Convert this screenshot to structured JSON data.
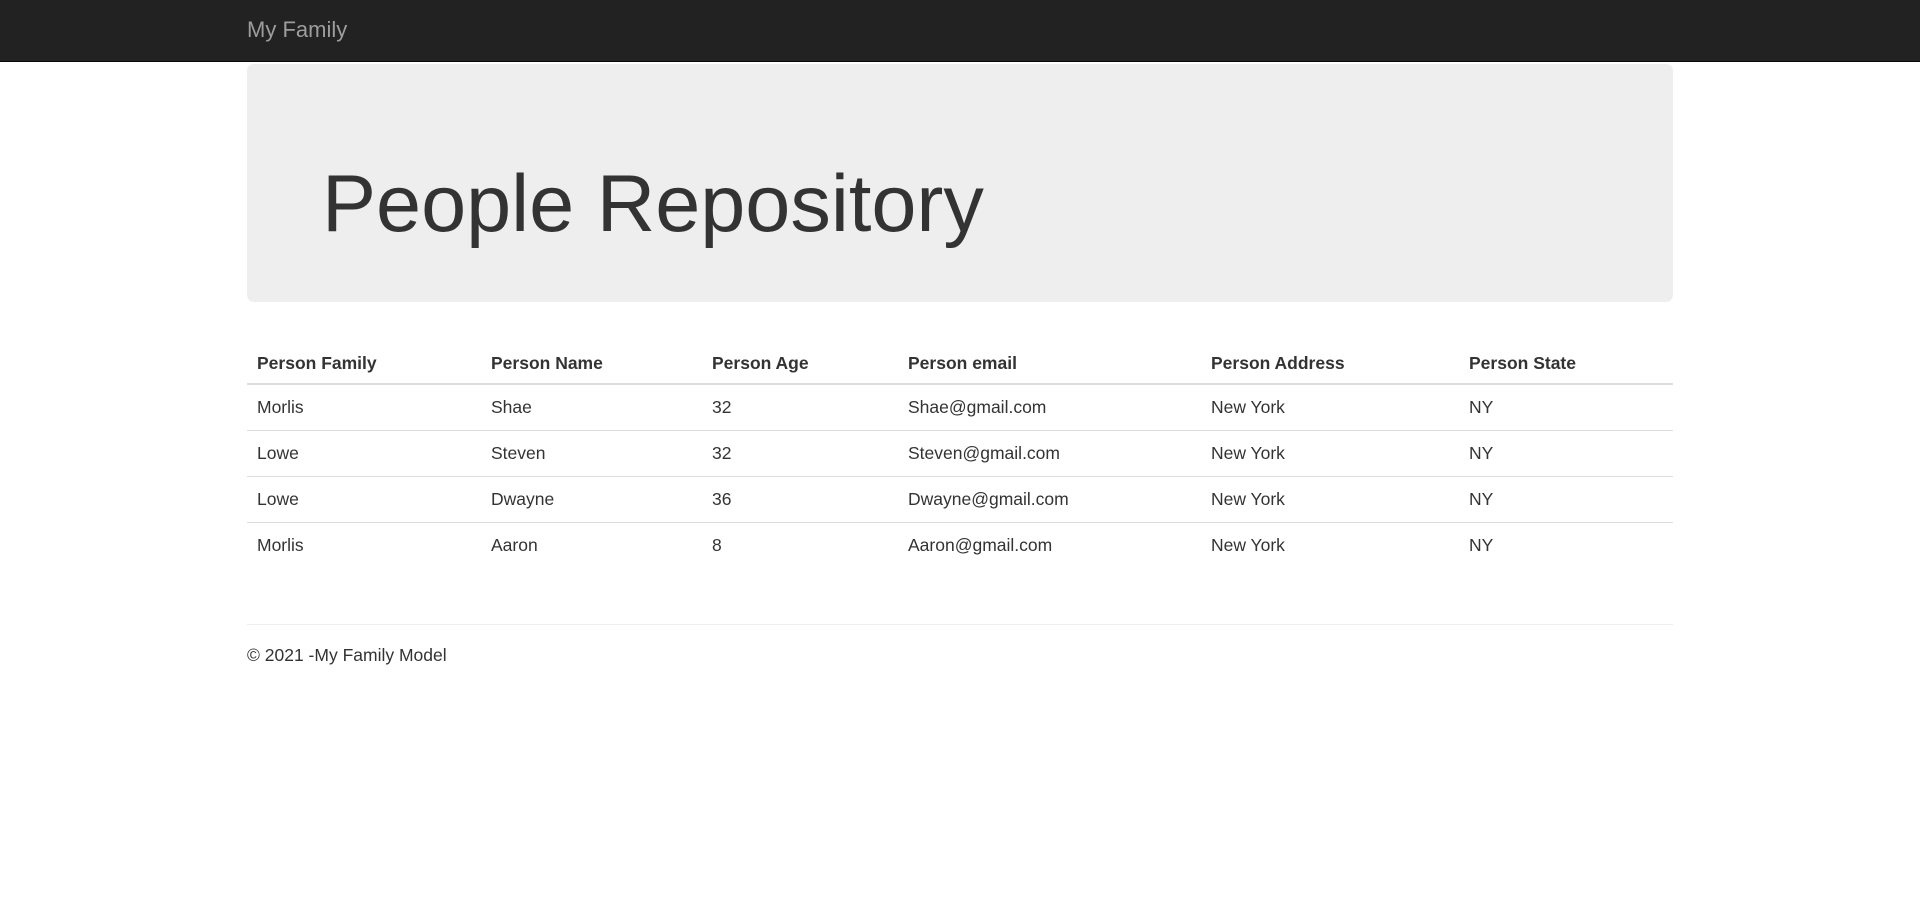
{
  "navbar": {
    "brand": "My Family"
  },
  "jumbotron": {
    "title": "People Repository"
  },
  "table": {
    "headers": [
      "Person Family",
      "Person Name",
      "Person Age",
      "Person email",
      "Person Address",
      "Person State"
    ],
    "rows": [
      [
        "Morlis",
        "Shae",
        "32",
        "Shae@gmail.com",
        "New York",
        "NY"
      ],
      [
        "Lowe",
        "Steven",
        "32",
        "Steven@gmail.com",
        "New York",
        "NY"
      ],
      [
        "Lowe",
        "Dwayne",
        "36",
        "Dwayne@gmail.com",
        "New York",
        "NY"
      ],
      [
        "Morlis",
        "Aaron",
        "8",
        "Aaron@gmail.com",
        "New York",
        "NY"
      ]
    ]
  },
  "footer": {
    "text": "© 2021 -My Family Model"
  },
  "colors": {
    "navbar_bg": "#222222",
    "brand_text": "#9d9d9d",
    "jumbotron_bg": "#eeeeee",
    "body_text": "#333333"
  }
}
